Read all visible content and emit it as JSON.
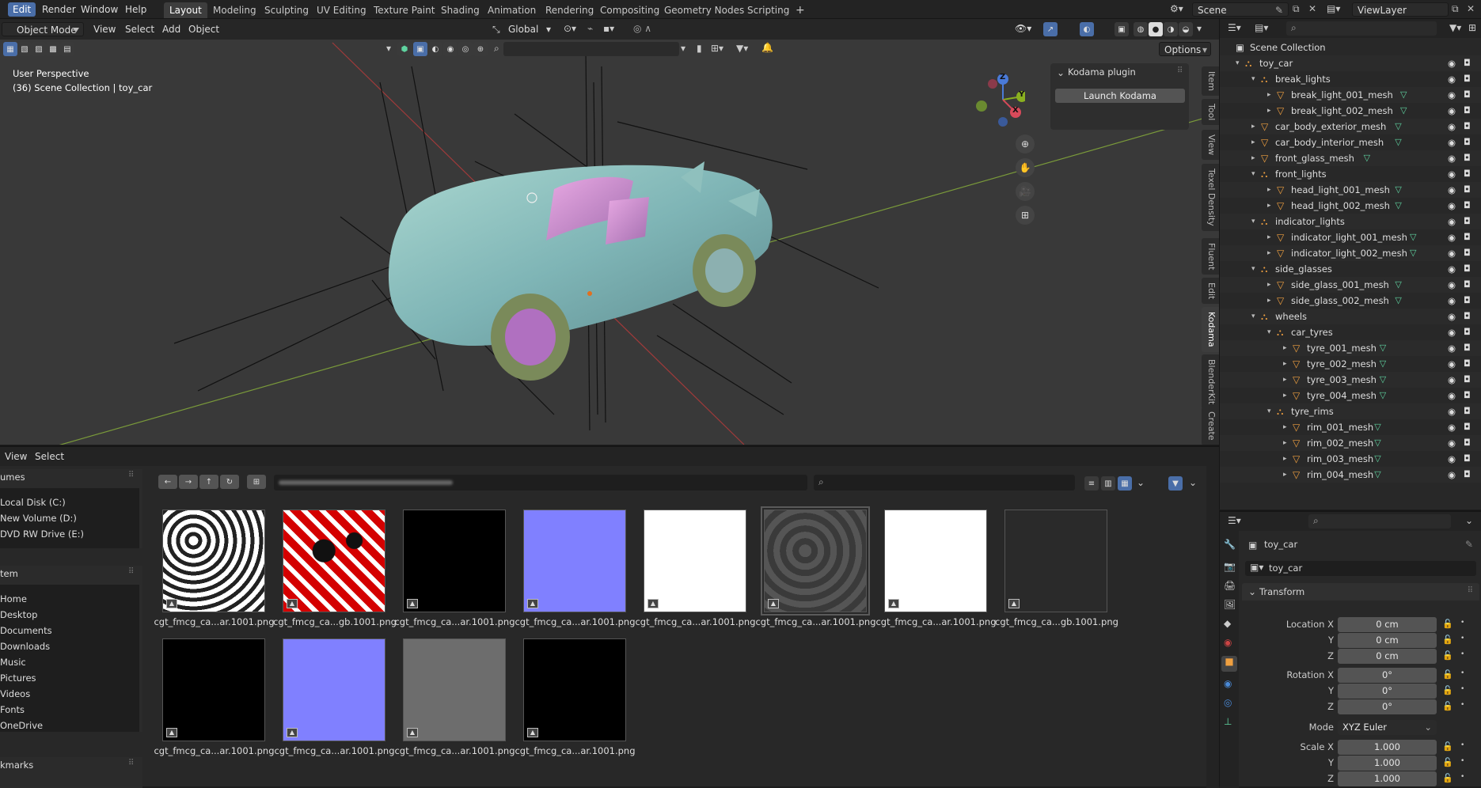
{
  "top_menu": [
    "Edit",
    "Render",
    "Window",
    "Help"
  ],
  "workspaces": [
    "Layout",
    "Modeling",
    "Sculpting",
    "UV Editing",
    "Texture Paint",
    "Shading",
    "Animation",
    "Rendering",
    "Compositing",
    "Geometry Nodes",
    "Scripting"
  ],
  "scene_name": "Scene",
  "view_layer": "ViewLayer",
  "viewport": {
    "mode": "Object Mode",
    "menus": [
      "View",
      "Select",
      "Add",
      "Object"
    ],
    "transform_orientation": "Global",
    "options_label": "Options",
    "overlay_line1": "User Perspective",
    "overlay_line2": "(36) Scene Collection | toy_car",
    "plugin_panel_title": "Kodama plugin",
    "plugin_button": "Launch Kodama",
    "side_tabs": [
      "Item",
      "Tool",
      "View",
      "Texel Density",
      "Fluent",
      "Edit",
      "Kodama",
      "BlenderKit",
      "Create"
    ],
    "gizmo": {
      "z": "Z",
      "y": "Y",
      "x": "X"
    }
  },
  "outliner": {
    "root": "Scene Collection",
    "rows": [
      {
        "label": "toy_car",
        "type": "collection"
      },
      {
        "label": "break_lights",
        "type": "collection"
      },
      {
        "label": "break_light_001_mesh",
        "type": "mesh"
      },
      {
        "label": "break_light_002_mesh",
        "type": "mesh"
      },
      {
        "label": "car_body_exterior_mesh",
        "type": "mesh"
      },
      {
        "label": "car_body_interior_mesh",
        "type": "mesh"
      },
      {
        "label": "front_glass_mesh",
        "type": "mesh"
      },
      {
        "label": "front_lights",
        "type": "collection"
      },
      {
        "label": "head_light_001_mesh",
        "type": "mesh"
      },
      {
        "label": "head_light_002_mesh",
        "type": "mesh"
      },
      {
        "label": "indicator_lights",
        "type": "collection"
      },
      {
        "label": "indicator_light_001_mesh",
        "type": "mesh"
      },
      {
        "label": "indicator_light_002_mesh",
        "type": "mesh"
      },
      {
        "label": "side_glasses",
        "type": "collection"
      },
      {
        "label": "side_glass_001_mesh",
        "type": "mesh"
      },
      {
        "label": "side_glass_002_mesh",
        "type": "mesh"
      },
      {
        "label": "wheels",
        "type": "collection"
      },
      {
        "label": "car_tyres",
        "type": "collection"
      },
      {
        "label": "tyre_001_mesh",
        "type": "mesh"
      },
      {
        "label": "tyre_002_mesh",
        "type": "mesh"
      },
      {
        "label": "tyre_003_mesh",
        "type": "mesh"
      },
      {
        "label": "tyre_004_mesh",
        "type": "mesh"
      },
      {
        "label": "tyre_rims",
        "type": "collection"
      },
      {
        "label": "rim_001_mesh",
        "type": "mesh"
      },
      {
        "label": "rim_002_mesh",
        "type": "mesh"
      },
      {
        "label": "rim_003_mesh",
        "type": "mesh"
      },
      {
        "label": "rim_004_mesh",
        "type": "mesh"
      }
    ]
  },
  "file_browser": {
    "menus": [
      "View",
      "Select"
    ],
    "volumes_header": "umes",
    "volumes": [
      "Local Disk (C:)",
      "New Volume (D:)",
      "DVD RW Drive (E:)"
    ],
    "system_header": "tem",
    "system": [
      "Home",
      "Desktop",
      "Documents",
      "Downloads",
      "Music",
      "Pictures",
      "Videos",
      "Fonts",
      "OneDrive"
    ],
    "bookmarks_header": "kmarks",
    "thumbnails": [
      {
        "name": "cgt_fmcg_ca...ar.1001.png",
        "style": "bw"
      },
      {
        "name": "cgt_fmcg_ca...gb.1001.png",
        "style": "red"
      },
      {
        "name": "cgt_fmcg_ca...ar.1001.png",
        "style": "black"
      },
      {
        "name": "cgt_fmcg_ca...ar.1001.png",
        "style": "normal"
      },
      {
        "name": "cgt_fmcg_ca...ar.1001.png",
        "style": "white"
      },
      {
        "name": "cgt_fmcg_ca...ar.1001.png",
        "style": "darkgray"
      },
      {
        "name": "cgt_fmcg_ca...ar.1001.png",
        "style": "white"
      },
      {
        "name": "cgt_fmcg_ca...gb.1001.png",
        "style": "dark"
      },
      {
        "name": "cgt_fmcg_ca...ar.1001.png",
        "style": "black"
      },
      {
        "name": "cgt_fmcg_ca...ar.1001.png",
        "style": "normal"
      },
      {
        "name": "cgt_fmcg_ca...ar.1001.png",
        "style": "gray"
      },
      {
        "name": "cgt_fmcg_ca...ar.1001.png",
        "style": "black"
      }
    ]
  },
  "properties": {
    "object_name": "toy_car",
    "data_name": "toy_car",
    "panel": "Transform",
    "location": {
      "label": "Location X",
      "x": "0 cm",
      "y": "0 cm",
      "z": "0 cm"
    },
    "rotation": {
      "label": "Rotation X",
      "x": "0°",
      "y": "0°",
      "z": "0°"
    },
    "mode": {
      "label": "Mode",
      "value": "XYZ Euler"
    },
    "scale": {
      "label": "Scale X",
      "x": "1.000",
      "y": "1.000",
      "z": "1.000"
    },
    "axis_y": "Y",
    "axis_z": "Z"
  }
}
